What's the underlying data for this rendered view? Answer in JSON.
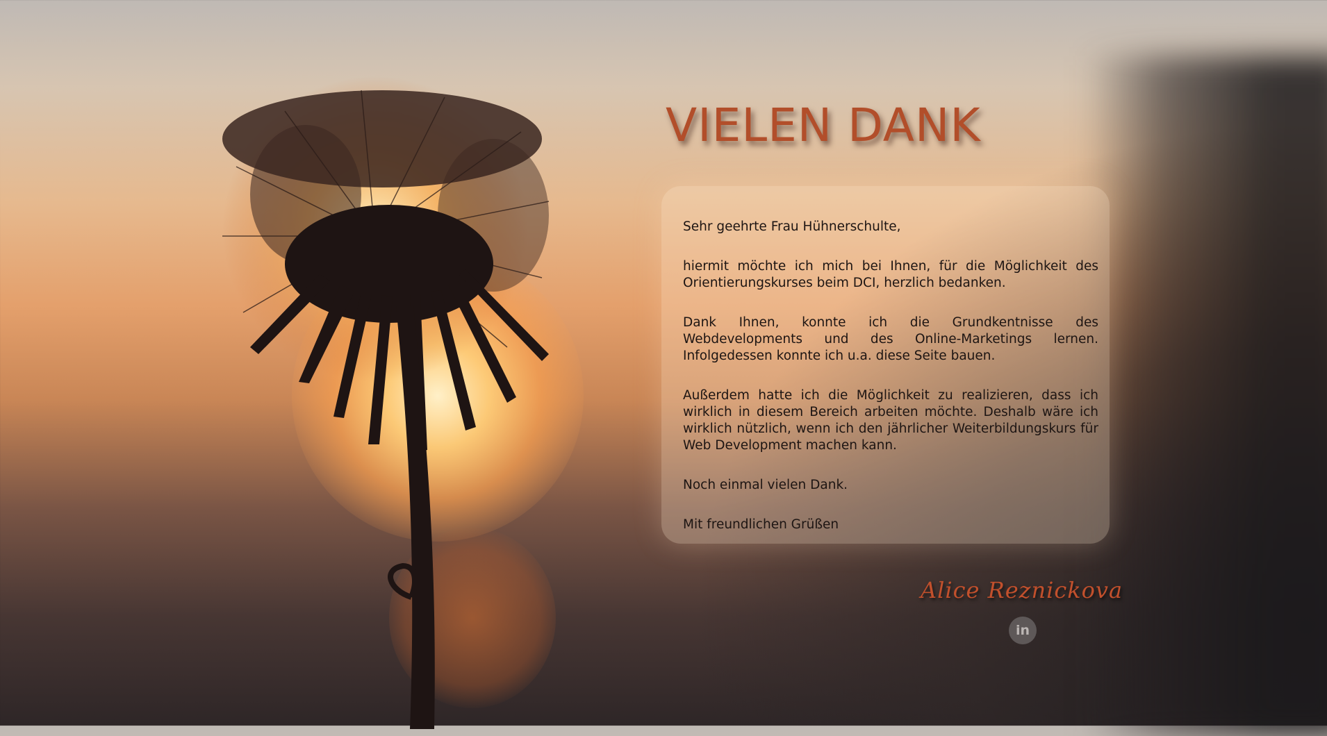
{
  "title": "VIELEN DANK",
  "letter": {
    "greeting": "Sehr geehrte Frau Hühnerschulte,",
    "p1": "hiermit möchte ich mich bei Ihnen, für die Möglichkeit des Orientierungskurses beim DCI, herzlich bedanken.",
    "p2": "Dank Ihnen, konnte ich die Grundkentnisse des Webdevelopments und des Online-Marketings lernen. Infolgedessen konnte ich u.a. diese Seite bauen.",
    "p3": "Außerdem hatte ich die Möglichkeit zu realizieren, dass ich wirklich in diesem Bereich arbeiten möchte. Deshalb wäre ich wirklich nützlich, wenn ich den jährlicher Weiterbildungskurs für Web Development machen kann.",
    "p4": "Noch einmal vielen Dank.",
    "closing": "Mit freundlichen Grüßen"
  },
  "signature": "Alice Reznickova",
  "social": {
    "linkedin_label": "in",
    "icon": "linkedin-icon"
  },
  "colors": {
    "accent": "#b24e2a",
    "signature": "#c2502c",
    "text": "#1d1513"
  }
}
